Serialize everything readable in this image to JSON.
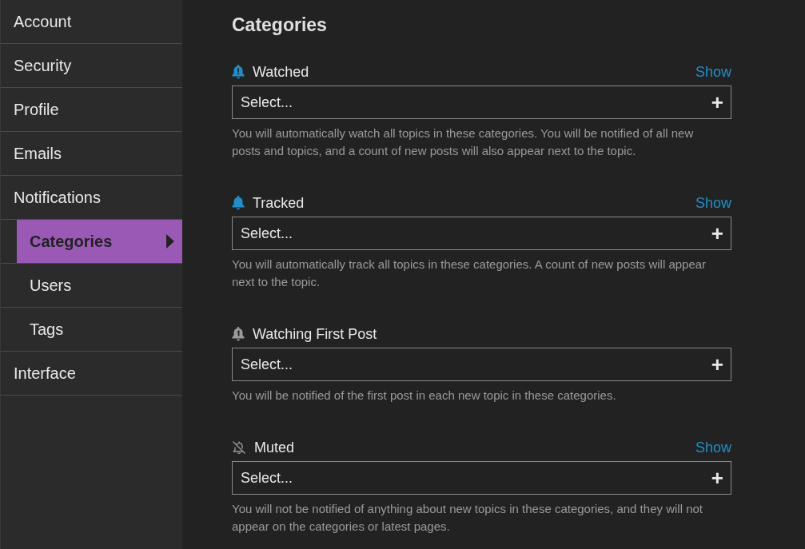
{
  "sidebar": {
    "items": [
      {
        "label": "Account",
        "selected": false
      },
      {
        "label": "Security",
        "selected": false
      },
      {
        "label": "Profile",
        "selected": false
      },
      {
        "label": "Emails",
        "selected": false
      },
      {
        "label": "Notifications",
        "selected": false,
        "children": [
          {
            "label": "Categories",
            "selected": true
          },
          {
            "label": "Users",
            "selected": false
          },
          {
            "label": "Tags",
            "selected": false
          }
        ]
      },
      {
        "label": "Interface",
        "selected": false
      }
    ]
  },
  "heading": "Categories",
  "sections": [
    {
      "kind": "watched",
      "label": "Watched",
      "link": "Show",
      "placeholder": "Select...",
      "button": "+",
      "description": "You will automatically watch all topics in these categories. You will be notified of all new posts and topics, and a count of new posts will also appear next to the topic."
    },
    {
      "kind": "tracked",
      "label": "Tracked",
      "link": "Show",
      "placeholder": "Select...",
      "button": "+",
      "description": "You will automatically track all topics in these categories. A count of new posts will appear next to the topic."
    },
    {
      "kind": "first",
      "label": "Watching First Post",
      "placeholder": "Select...",
      "button": "+",
      "description": "You will be notified of the first post in each new topic in these categories."
    },
    {
      "kind": "muted",
      "label": "Muted",
      "link": "Show",
      "placeholder": "Select...",
      "button": "+",
      "description": "You will not be notified of anything about new topics in these categories, and they will not appear on the categories or latest pages."
    }
  ]
}
